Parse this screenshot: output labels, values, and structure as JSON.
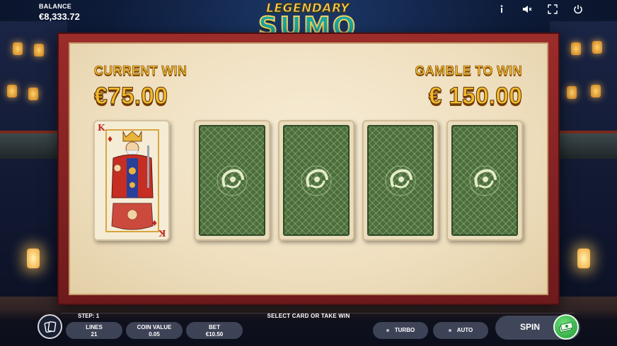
{
  "header": {
    "balance_label": "BALANCE",
    "balance_value": "€8,333.72",
    "logo_top": "LEGENDARY",
    "logo_main": "SUMO",
    "icons": [
      "info-icon",
      "mute-icon",
      "fullscreen-icon",
      "power-icon"
    ]
  },
  "gamble": {
    "current_win_label": "CURRENT WIN",
    "current_win_value": "€75.00",
    "gamble_label": "GAMBLE TO WIN",
    "gamble_value": "€ 150.00",
    "dealer_card": {
      "rank": "K",
      "suit": "♦"
    },
    "hidden_cards": 4
  },
  "footer": {
    "step_label": "STEP: 1",
    "status_message": "SELECT CARD OR TAKE WIN",
    "lines_label": "LINES",
    "lines_value": "21",
    "coin_label": "COIN VALUE",
    "coin_value": "0.05",
    "bet_label": "BET",
    "bet_value": "€10.50",
    "turbo_label": "TURBO",
    "auto_label": "AUTO",
    "spin_label": "SPIN"
  },
  "colors": {
    "gold": "#f2b92c",
    "frame": "#9b2c2a",
    "card_back": "#4b6e3c",
    "spin_green": "#2eb845"
  }
}
